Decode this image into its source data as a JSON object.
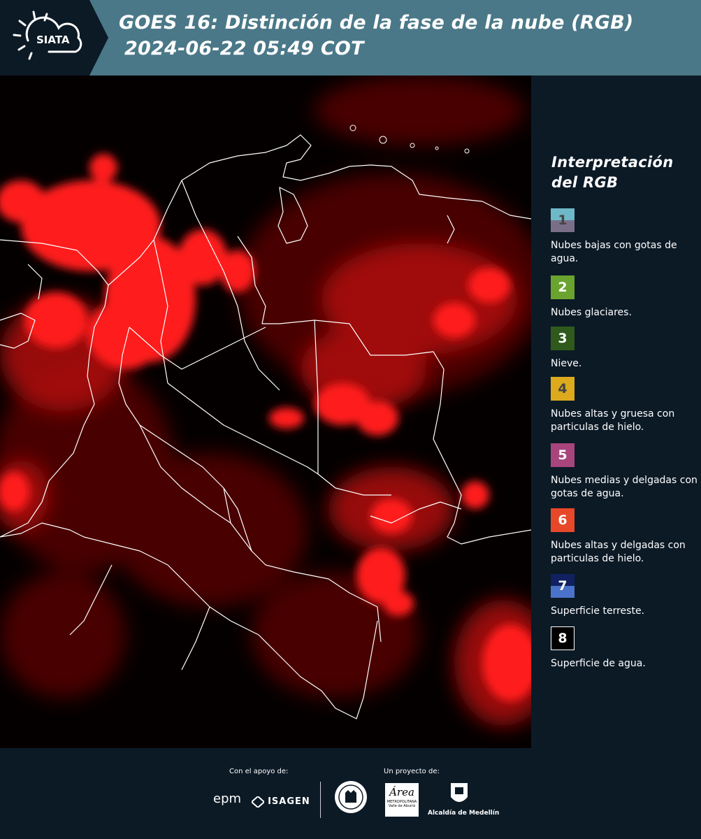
{
  "header": {
    "logo_text": "SIATA",
    "title_line1": "GOES 16: Distinción de la fase de la nube (RGB)",
    "title_line2": "2024-06-22 05:49 COT"
  },
  "legend": {
    "title_line1": "Interpretación",
    "title_line2": "del RGB",
    "items": [
      {
        "number": "1",
        "label": "Nubes bajas con gotas de agua.",
        "color_top": "#6fb8c8",
        "color_bottom": "#7a6f88"
      },
      {
        "number": "2",
        "label": "Nubes glaciares.",
        "color_top": "#6aa42e",
        "color_bottom": "#6aa42e"
      },
      {
        "number": "3",
        "label": "Nieve.",
        "color_top": "#2f5a1c",
        "color_bottom": "#2f5a1c"
      },
      {
        "number": "4",
        "label": "Nubes altas y gruesa con particulas de hielo.",
        "color_top": "#dcaa1c",
        "color_bottom": "#dcaa1c"
      },
      {
        "number": "5",
        "label": "Nubes medias y delgadas con gotas de agua.",
        "color_top": "#a8457c",
        "color_bottom": "#a8457c"
      },
      {
        "number": "6",
        "label": "Nubes altas y delgadas con particulas de hielo.",
        "color_top": "#e8482a",
        "color_bottom": "#e8482a"
      },
      {
        "number": "7",
        "label": "Superficie terreste.",
        "color_top": "#102060",
        "color_bottom": "#4a72c8"
      },
      {
        "number": "8",
        "label": "Superficie de agua.",
        "color_top": "#000000",
        "color_bottom": "#000000"
      }
    ]
  },
  "footer": {
    "support_label": "Con el apoyo de:",
    "project_label": "Un proyecto de:",
    "epm": "epm",
    "isagen": "ISAGEN",
    "area_line1": "Área",
    "area_line2": "METROPOLITANA",
    "area_line3": "Valle de Aburrá",
    "alcaldia": "Alcaldía de Medellín"
  },
  "colors": {
    "header_bg": "#4a7888",
    "panel_bg": "#0c1a26",
    "cloud_red": "#ff1a1a"
  }
}
